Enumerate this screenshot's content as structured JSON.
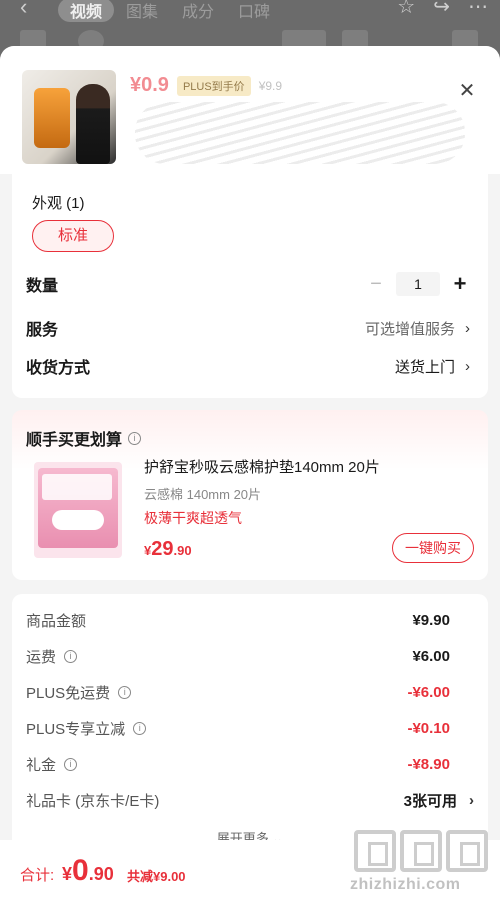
{
  "background": {
    "tabs": [
      "视频",
      "图集",
      "成分",
      "口碑"
    ],
    "active_tab": "视频"
  },
  "product": {
    "price": "¥0.9",
    "plus_badge": "PLUS到手价",
    "original_price": "¥9.9"
  },
  "options": {
    "appearance_title": "外观 (1)",
    "appearance_option": "标准",
    "quantity_label": "数量",
    "quantity_value": "1",
    "service_label": "服务",
    "service_value": "可选增值服务",
    "delivery_label": "收货方式",
    "delivery_value": "送货上门"
  },
  "addon": {
    "title": "顺手买更划算",
    "name": "护舒宝秒吸云感棉护垫140mm 20片",
    "spec": "云感棉 140mm 20片",
    "tag": "极薄干爽超透气",
    "price_currency": "¥",
    "price_int": "29",
    "price_dec": ".90",
    "buy_label": "一键购买"
  },
  "summary": {
    "rows": [
      {
        "label": "商品金额",
        "value": "¥9.90",
        "info": false,
        "red": false
      },
      {
        "label": "运费",
        "value": "¥6.00",
        "info": true,
        "red": false
      },
      {
        "label": "PLUS免运费",
        "value": "-¥6.00",
        "info": true,
        "red": true
      },
      {
        "label": "PLUS专享立减",
        "value": "-¥0.10",
        "info": true,
        "red": true
      },
      {
        "label": "礼金",
        "value": "-¥8.90",
        "info": true,
        "red": true
      }
    ],
    "giftcard_label": "礼品卡 (京东卡/E卡)",
    "giftcard_value": "3张可用",
    "expand_label": "展开更多"
  },
  "footer": {
    "total_label": "合计:",
    "total_currency": "¥",
    "total_int": "0",
    "total_dec": ".90",
    "saving": "共减¥9.00"
  },
  "watermark": {
    "text": "zhizhizhi.com"
  },
  "colors": {
    "accent": "#e8303a",
    "plus_gold": "#f6e6b8"
  }
}
